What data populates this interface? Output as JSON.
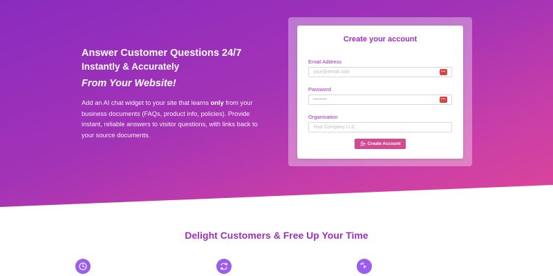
{
  "hero": {
    "line1": "Answer Customer Questions 24/7",
    "line2": "Instantly & Accurately",
    "line3": "From Your Website!",
    "desc_before": "Add an AI chat widget to your site that learns ",
    "desc_bold": "only",
    "desc_after": " from your business documents (FAQs, product info, policies). Provide instant, reliable answers to visitor questions, with links back to your source documents."
  },
  "form": {
    "title": "Create your account",
    "email_label": "Email Address",
    "email_placeholder": "your@email.com",
    "password_label": "Password",
    "password_placeholder": "••••••••",
    "org_label": "Organisation",
    "org_placeholder": "Your Company LLC",
    "submit_label": "Create Account"
  },
  "features": {
    "title": "Delight Customers & Free Up Your Time",
    "icons": [
      "clock-icon",
      "refresh-icon",
      "sparkle-cursor-icon"
    ]
  },
  "colors": {
    "accent": "#9b30b6",
    "button": "#d44a92",
    "icon_bg": "#9b5cf0",
    "password_icon": "#d94545"
  }
}
